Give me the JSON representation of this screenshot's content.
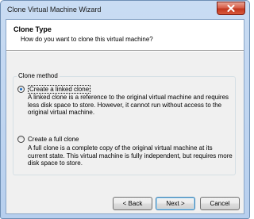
{
  "window": {
    "title": "Clone Virtual Machine Wizard",
    "close_symbol": "close-icon"
  },
  "header": {
    "title": "Clone Type",
    "subtitle": "How do you want to clone this virtual machine?"
  },
  "clone_method": {
    "legend": "Clone method",
    "options": [
      {
        "label": "Create a linked clone",
        "checked": true,
        "description": "A linked clone is a reference to the original virtual machine and requires less disk space to store. However, it cannot run without access to the original virtual machine."
      },
      {
        "label": "Create a full clone",
        "checked": false,
        "description": "A full clone is a complete copy of the original virtual machine at its current state. This virtual machine is fully independent, but requires more disk space to store."
      }
    ]
  },
  "buttons": {
    "back": "< Back",
    "next": "Next >",
    "cancel": "Cancel"
  },
  "colors": {
    "title_bar": "#c9dcf3",
    "client_bg": "#f0f0f0",
    "close_button": "#c2371f"
  }
}
